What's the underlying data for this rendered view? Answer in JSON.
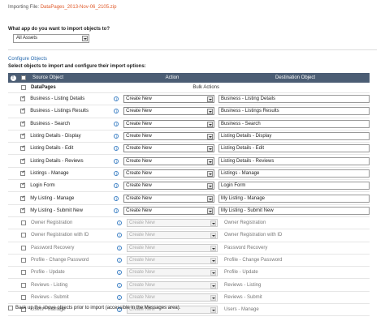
{
  "import_file": {
    "label": "Importing File:",
    "filename": "DataPages_2013-Nov-06_2105.zip"
  },
  "question": "What app do you want to import objects to?",
  "app_select": {
    "value": "All Assets"
  },
  "configure_label": "Configure Objects",
  "instructions": "Select objects to import and configure their import options:",
  "table": {
    "headers": {
      "source": "Source Object",
      "action": "Action",
      "destination": "Destination Object"
    },
    "group": {
      "name": "DataPages",
      "bulk_actions": "Bulk Actions"
    },
    "rows": [
      {
        "source": "Business - Listing Details",
        "action": "Create New",
        "dest": "Business - Listing Details",
        "checked": true
      },
      {
        "source": "Business - Listings Results",
        "action": "Create New",
        "dest": "Business - Listings Results",
        "checked": true
      },
      {
        "source": "Business - Search",
        "action": "Create New",
        "dest": "Business - Search",
        "checked": true
      },
      {
        "source": "Listing Details - Display",
        "action": "Create New",
        "dest": "Listing Details - Display",
        "checked": true
      },
      {
        "source": "Listing Details - Edit",
        "action": "Create New",
        "dest": "Listing Details - Edit",
        "checked": true
      },
      {
        "source": "Listing Details - Reviews",
        "action": "Create New",
        "dest": "Listing Details - Reviews",
        "checked": true
      },
      {
        "source": "Listings - Manage",
        "action": "Create New",
        "dest": "Listings - Manage",
        "checked": true
      },
      {
        "source": "Login Form",
        "action": "Create New",
        "dest": "Login Form",
        "checked": true
      },
      {
        "source": "My Listing - Manage",
        "action": "Create New",
        "dest": "My Listing - Manage",
        "checked": true
      },
      {
        "source": "My Listing - Submit New",
        "action": "Create New",
        "dest": "My Listing - Submit New",
        "checked": true
      },
      {
        "source": "Owner Registration",
        "action": "Create New",
        "dest": "Owner Registration",
        "checked": false
      },
      {
        "source": "Owner Registration with ID",
        "action": "Create New",
        "dest": "Owner Registration with ID",
        "checked": false
      },
      {
        "source": "Password Recovery",
        "action": "Create New",
        "dest": "Password Recovery",
        "checked": false
      },
      {
        "source": "Profile - Change Password",
        "action": "Create New",
        "dest": "Profile - Change Password",
        "checked": false
      },
      {
        "source": "Profile - Update",
        "action": "Create New",
        "dest": "Profile - Update",
        "checked": false
      },
      {
        "source": "Reviews - Listing",
        "action": "Create New",
        "dest": "Reviews - Listing",
        "checked": false
      },
      {
        "source": "Reviews - Submit",
        "action": "Create New",
        "dest": "Reviews - Submit",
        "checked": false
      },
      {
        "source": "Users - Manage",
        "action": "Create New",
        "dest": "Users - Manage",
        "checked": false
      }
    ]
  },
  "backup_label": "Back up the above objects prior to import (accessible in the Messages area)."
}
